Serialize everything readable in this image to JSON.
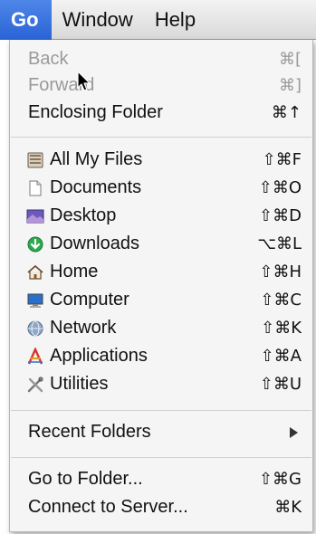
{
  "menubar": {
    "items": [
      {
        "label": "Go"
      },
      {
        "label": "Window"
      },
      {
        "label": "Help"
      }
    ]
  },
  "menu": {
    "back": {
      "label": "Back",
      "shortcut": "⌘["
    },
    "forward": {
      "label": "Forward",
      "shortcut": "⌘]"
    },
    "enclosing": {
      "label": "Enclosing Folder",
      "shortcut": "⌘↑"
    },
    "places": [
      {
        "label": "All My Files",
        "shortcut": "⇧⌘F",
        "icon": "all-my-files-icon"
      },
      {
        "label": "Documents",
        "shortcut": "⇧⌘O",
        "icon": "documents-icon"
      },
      {
        "label": "Desktop",
        "shortcut": "⇧⌘D",
        "icon": "desktop-icon"
      },
      {
        "label": "Downloads",
        "shortcut": "⌥⌘L",
        "icon": "downloads-icon"
      },
      {
        "label": "Home",
        "shortcut": "⇧⌘H",
        "icon": "home-icon"
      },
      {
        "label": "Computer",
        "shortcut": "⇧⌘C",
        "icon": "computer-icon"
      },
      {
        "label": "Network",
        "shortcut": "⇧⌘K",
        "icon": "network-icon"
      },
      {
        "label": "Applications",
        "shortcut": "⇧⌘A",
        "icon": "applications-icon"
      },
      {
        "label": "Utilities",
        "shortcut": "⇧⌘U",
        "icon": "utilities-icon"
      }
    ],
    "recent": {
      "label": "Recent Folders"
    },
    "goto": {
      "label": "Go to Folder...",
      "shortcut": "⇧⌘G"
    },
    "connect": {
      "label": "Connect to Server...",
      "shortcut": "⌘K"
    }
  },
  "colors": {
    "active_menu": "#2a63d6",
    "disabled_text": "#9a9a9a"
  }
}
